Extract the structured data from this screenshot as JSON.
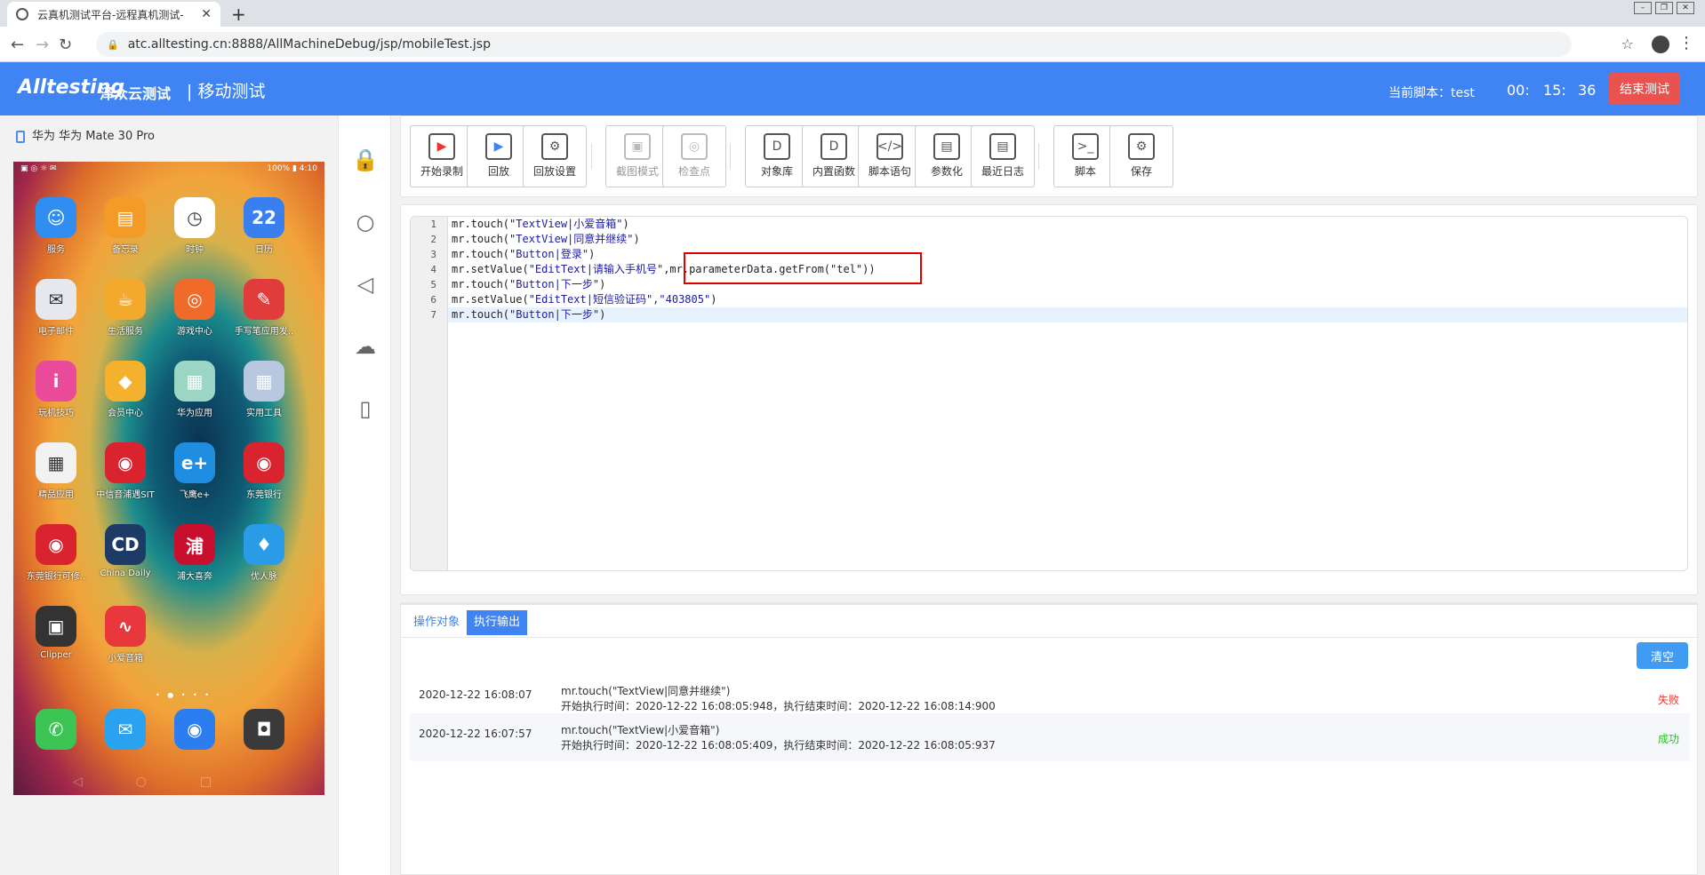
{
  "browser": {
    "tab_title": "云真机测试平台-远程真机测试-",
    "url": "atc.alltesting.cn:8888/AllMachineDebug/jsp/mobileTest.jsp"
  },
  "header": {
    "logo": "Alltesting",
    "logo_cn": "泽众云测试",
    "section": "| 移动测试",
    "current_script_label": "当前脚本：test",
    "timer": {
      "h": "00:",
      "m": "15:",
      "s": "36"
    },
    "end_button": "结束测试"
  },
  "device": {
    "name": "华为 华为 Mate 30 Pro",
    "status_left": "▣ ◎ ☼ ✉",
    "status_right": "100% ▮ 4:10",
    "apps": [
      {
        "label": "服务",
        "icon": "☺",
        "color": "#2f8ef0"
      },
      {
        "label": "备忘录",
        "icon": "▤",
        "color": "#f39a27"
      },
      {
        "label": "时钟",
        "icon": "◷",
        "color": "#ffffff"
      },
      {
        "label": "日历",
        "icon": "22",
        "color": "#3a7ff0"
      },
      {
        "label": "电子邮件",
        "icon": "✉",
        "color": "#e7e7ee"
      },
      {
        "label": "生活服务",
        "icon": "☕",
        "color": "#f3a92b"
      },
      {
        "label": "游戏中心",
        "icon": "◎",
        "color": "#f06a2a"
      },
      {
        "label": "手写笔应用发..",
        "icon": "✎",
        "color": "#e23b3b"
      },
      {
        "label": "玩机技巧",
        "icon": "i",
        "color": "#e94b9a"
      },
      {
        "label": "会员中心",
        "icon": "◆",
        "color": "#f3b12d"
      },
      {
        "label": "华为应用",
        "icon": "▦",
        "color": "#9bd6c4"
      },
      {
        "label": "实用工具",
        "icon": "▦",
        "color": "#b8c8e0"
      },
      {
        "label": "精品应用",
        "icon": "▦",
        "color": "#f2f2f2"
      },
      {
        "label": "中信音浦遇SIT",
        "icon": "◉",
        "color": "#d9232e"
      },
      {
        "label": "飞鹰e+",
        "icon": "e+",
        "color": "#1f8de0"
      },
      {
        "label": "东莞银行",
        "icon": "◉",
        "color": "#d9232e"
      },
      {
        "label": "东莞银行可修..",
        "icon": "◉",
        "color": "#d9232e"
      },
      {
        "label": "China Daily",
        "icon": "CD",
        "color": "#1e3a66"
      },
      {
        "label": "浦大喜奔",
        "icon": "浦",
        "color": "#c8102e"
      },
      {
        "label": "优人脉",
        "icon": "♦",
        "color": "#2a9be6"
      },
      {
        "label": "Clipper",
        "icon": "▣",
        "color": "#333333"
      },
      {
        "label": "小爱音箱",
        "icon": "∿",
        "color": "#e8383d"
      }
    ],
    "dock": [
      {
        "icon": "✆",
        "color": "#3cc455"
      },
      {
        "icon": "✉",
        "color": "#29a3f0"
      },
      {
        "icon": "◉",
        "color": "#2b7df0"
      },
      {
        "icon": "◘",
        "color": "#3a3a3a"
      }
    ]
  },
  "side_tools": [
    "lock-icon",
    "home-circle-icon",
    "back-triangle-icon",
    "upload-cloud-icon",
    "phone-off-icon"
  ],
  "toolbar": {
    "buttons": [
      {
        "label": "开始录制",
        "icon": "▶",
        "disabled": false
      },
      {
        "label": "回放",
        "icon": "▶",
        "disabled": false
      },
      {
        "label": "回放设置",
        "icon": "⚙",
        "disabled": false
      },
      {
        "label": "截图模式",
        "icon": "▣",
        "disabled": true
      },
      {
        "label": "检查点",
        "icon": "◎",
        "disabled": true
      },
      {
        "label": "对象库",
        "icon": "D",
        "disabled": false
      },
      {
        "label": "内置函数",
        "icon": "D",
        "disabled": false
      },
      {
        "label": "脚本语句",
        "icon": "</>",
        "disabled": false
      },
      {
        "label": "参数化",
        "icon": "▤",
        "disabled": false
      },
      {
        "label": "最近日志",
        "icon": "▤",
        "disabled": false
      },
      {
        "label": "脚本",
        "icon": ">_",
        "disabled": false
      },
      {
        "label": "保存",
        "icon": "⚙",
        "disabled": false
      }
    ]
  },
  "editor": {
    "lines": [
      {
        "no": "1",
        "pre": "mr.touch(",
        "str": "\"TextView|小爱音箱\"",
        "post": ")"
      },
      {
        "no": "2",
        "pre": "mr.touch(",
        "str": "\"TextView|同意并继续\"",
        "post": ")"
      },
      {
        "no": "3",
        "pre": "mr.touch(",
        "str": "\"Button|登录\"",
        "post": ")"
      },
      {
        "no": "4",
        "pre": "mr.setValue(",
        "str": "\"EditText|请输入手机号\"",
        "post": ",mr.parameterData.getFrom(\"tel\"))"
      },
      {
        "no": "5",
        "pre": "mr.touch(",
        "str": "\"Button|下一步\"",
        "post": ")"
      },
      {
        "no": "6",
        "pre": "mr.setValue(",
        "str": "\"EditText|短信验证码\",\"403805\"",
        "post": ")"
      },
      {
        "no": "7",
        "pre": "mr.touch(",
        "str": "\"Button|下一步\"",
        "post": ")"
      }
    ]
  },
  "output": {
    "tabs": [
      "操作对象",
      "执行输出"
    ],
    "clear_button": "清空",
    "rows": [
      {
        "time": "2020-12-22 16:08:07",
        "cmd": "mr.touch(\"TextView|同意并继续\")",
        "detail": "开始执行时间：2020-12-22 16:08:05:948，执行结束时间：2020-12-22 16:08:14:900",
        "status": "失败",
        "status_color": "#e33"
      },
      {
        "time": "2020-12-22 16:07:57",
        "cmd": "mr.touch(\"TextView|小爱音箱\")",
        "detail": "开始执行时间：2020-12-22 16:08:05:409，执行结束时间：2020-12-22 16:08:05:937",
        "status": "成功",
        "status_color": "#22c322"
      }
    ]
  }
}
